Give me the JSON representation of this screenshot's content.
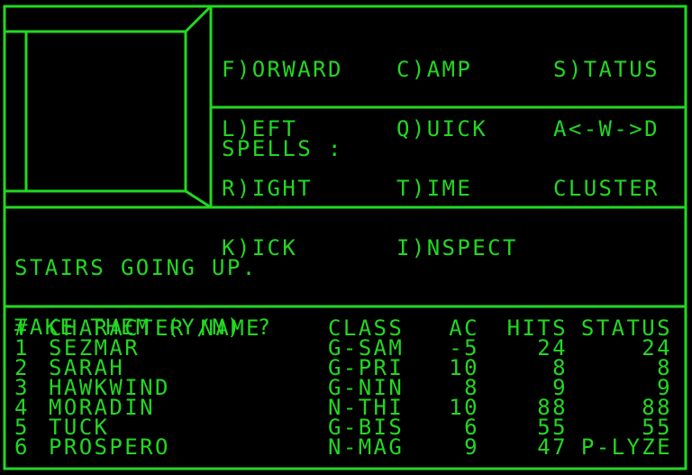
{
  "colors": {
    "foreground": "#22d822",
    "background": "#000000"
  },
  "commands": {
    "column1": [
      "F)ORWARD",
      "L)EFT",
      "R)IGHT",
      "K)ICK"
    ],
    "column2": [
      "C)AMP",
      "Q)UICK",
      "T)IME",
      "I)NSPECT"
    ],
    "column3": [
      "S)TATUS",
      "A<-W->D",
      "CLUSTER"
    ]
  },
  "spells": {
    "label": "SPELLS :"
  },
  "message": {
    "lines": [
      "STAIRS GOING UP.",
      "TAKE THEM (Y/N) ?"
    ]
  },
  "party": {
    "headers": {
      "num": "#",
      "name": "CHARACTER NAME",
      "class": "CLASS",
      "ac": "AC",
      "hits": "HITS",
      "status": "STATUS"
    },
    "rows": [
      {
        "num": "1",
        "name": "SEZMAR",
        "class": "G-SAM",
        "ac": "-5",
        "hits": "24",
        "status": "24"
      },
      {
        "num": "2",
        "name": "SARAH",
        "class": "G-PRI",
        "ac": "10",
        "hits": "8",
        "status": "8"
      },
      {
        "num": "3",
        "name": "HAWKWIND",
        "class": "G-NIN",
        "ac": "8",
        "hits": "9",
        "status": "9"
      },
      {
        "num": "4",
        "name": "MORADIN",
        "class": "N-THI",
        "ac": "10",
        "hits": "88",
        "status": "88"
      },
      {
        "num": "5",
        "name": "TUCK",
        "class": "G-BIS",
        "ac": "6",
        "hits": "55",
        "status": "55"
      },
      {
        "num": "6",
        "name": "PROSPERO",
        "class": "N-MAG",
        "ac": "9",
        "hits": "47",
        "status": "P-LYZE"
      }
    ]
  }
}
